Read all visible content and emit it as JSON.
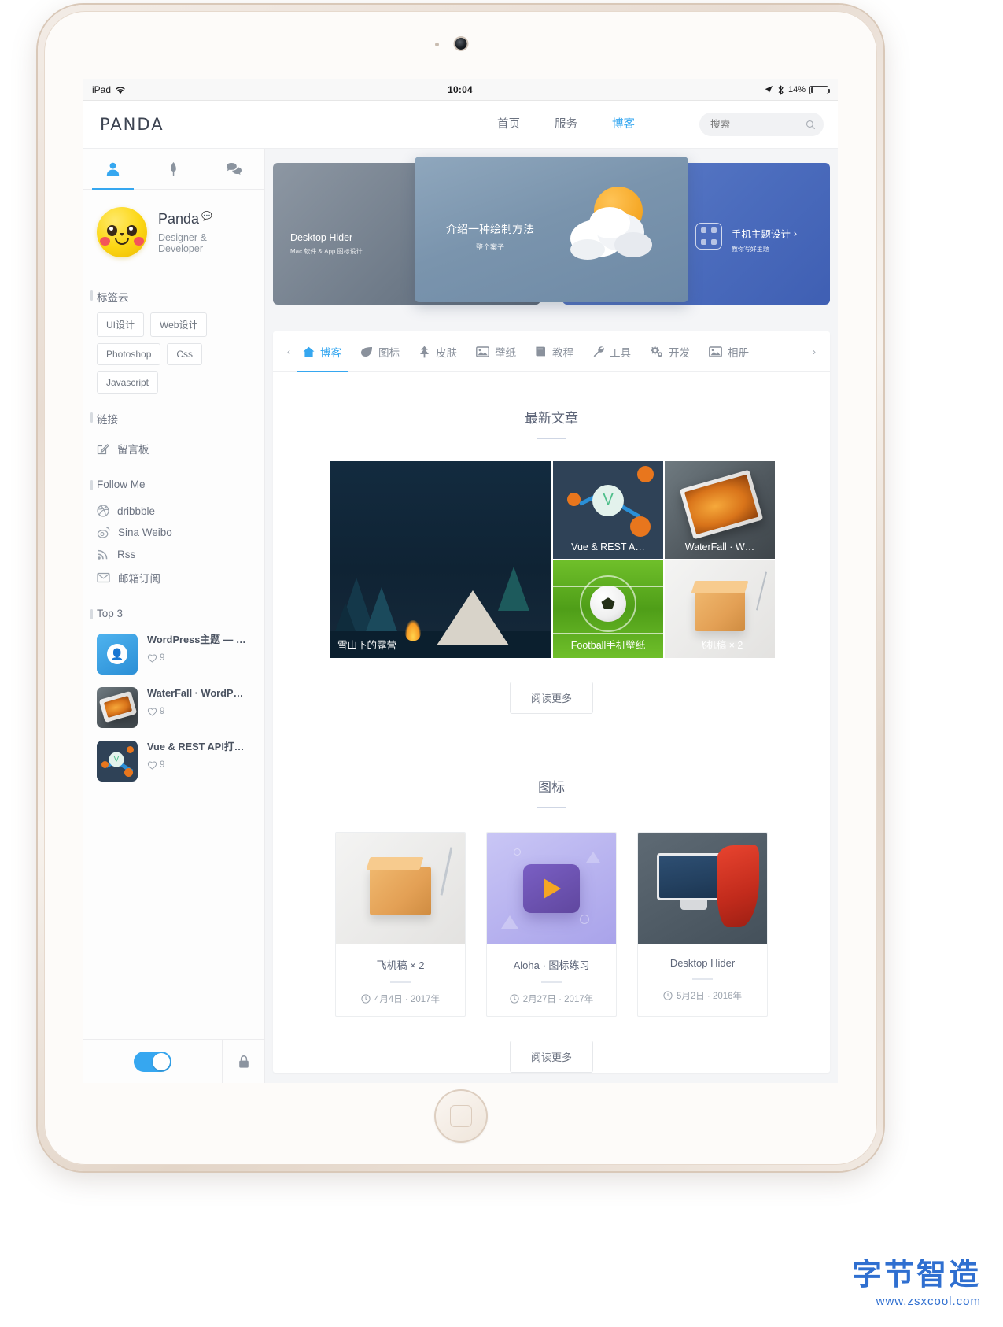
{
  "statusbar": {
    "carrier": "iPad",
    "wifi_icon": "wifi-icon",
    "time": "10:04",
    "location_icon": "location-arrow-icon",
    "bluetooth_icon": "bluetooth-icon",
    "battery_text": "14%"
  },
  "header": {
    "logo": "PANDA",
    "nav": [
      {
        "label": "首页",
        "active": false
      },
      {
        "label": "服务",
        "active": false
      },
      {
        "label": "博客",
        "active": true
      }
    ],
    "search": {
      "placeholder": "搜索",
      "value": "",
      "icon": "search-icon"
    }
  },
  "sidebar": {
    "tabs": [
      {
        "icon": "user-icon",
        "active": true
      },
      {
        "icon": "feather-icon",
        "active": false
      },
      {
        "icon": "comments-icon",
        "active": false
      }
    ],
    "profile": {
      "name": "Panda",
      "role": "Designer & Developer",
      "badge_icon": "speech-bubble-icon"
    },
    "tagcloud": {
      "title": "标签云",
      "tags": [
        "UI设计",
        "Web设计",
        "Photoshop",
        "Css",
        "Javascript"
      ]
    },
    "links": {
      "title": "链接",
      "items": [
        {
          "label": "留言板",
          "icon": "pencil-square-icon"
        }
      ]
    },
    "follow": {
      "title": "Follow Me",
      "items": [
        {
          "label": "dribbble",
          "icon": "dribbble-icon"
        },
        {
          "label": "Sina Weibo",
          "icon": "weibo-icon"
        },
        {
          "label": "Rss",
          "icon": "rss-icon"
        },
        {
          "label": "邮箱订阅",
          "icon": "envelope-icon"
        }
      ]
    },
    "top3": {
      "title": "Top 3",
      "items": [
        {
          "title": "WordPress主题 — …",
          "likes": "9",
          "thumb": "wordpress-avatar-thumb"
        },
        {
          "title": "WaterFall · WordP…",
          "likes": "9",
          "thumb": "waterfall-tablet-thumb"
        },
        {
          "title": "Vue & REST API打…",
          "likes": "9",
          "thumb": "vue-nodes-thumb"
        }
      ],
      "like_icon": "heart-icon"
    },
    "footer": {
      "toggle_on": true,
      "toggle_name": "night-mode-toggle",
      "lock_icon": "lock-icon"
    }
  },
  "carousel": {
    "slides": [
      {
        "title": "Desktop Hider",
        "subtitle": "Mac 软件 & App 图标设计",
        "position": "left"
      },
      {
        "title": "介绍一种绘制方法",
        "subtitle": "整个案子",
        "position": "center",
        "active": true
      },
      {
        "title": "手机主题设计",
        "subtitle": "教你写好主题",
        "position": "right"
      }
    ]
  },
  "category_tabs": {
    "prev_arrow": "chevron-left-icon",
    "next_arrow": "chevron-right-icon",
    "items": [
      {
        "label": "博客",
        "icon": "home-icon",
        "active": true
      },
      {
        "label": "图标",
        "icon": "leaf-icon",
        "active": false
      },
      {
        "label": "皮肤",
        "icon": "tree-icon",
        "active": false
      },
      {
        "label": "壁纸",
        "icon": "image-icon",
        "active": false
      },
      {
        "label": "教程",
        "icon": "book-icon",
        "active": false
      },
      {
        "label": "工具",
        "icon": "wrench-icon",
        "active": false
      },
      {
        "label": "开发",
        "icon": "gears-icon",
        "active": false
      },
      {
        "label": "相册",
        "icon": "photo-icon",
        "active": false
      }
    ]
  },
  "articles_section": {
    "title": "最新文章",
    "tiles": [
      {
        "caption": "雪山下的露营",
        "art": "camping"
      },
      {
        "caption": "Vue & REST A…",
        "art": "vue"
      },
      {
        "caption": "WaterFall · W…",
        "art": "waterfall"
      },
      {
        "caption": "Football手机壁纸",
        "art": "football"
      },
      {
        "caption": "飞机稿 × 2",
        "art": "box"
      }
    ],
    "more_label": "阅读更多"
  },
  "icons_section": {
    "title": "图标",
    "cards": [
      {
        "title": "飞机稿 × 2",
        "date": "4月4日 · 2017年",
        "art": "box",
        "clock_icon": "clock-icon"
      },
      {
        "title": "Aloha · 图标练习",
        "date": "2月27日 · 2017年",
        "art": "aloha",
        "clock_icon": "clock-icon"
      },
      {
        "title": "Desktop Hider",
        "date": "5月2日 · 2016年",
        "art": "desktophider",
        "clock_icon": "clock-icon"
      }
    ],
    "more_label": "阅读更多"
  },
  "watermark": {
    "title": "字节智造",
    "subtitle": "www.zsxcool.com"
  },
  "colors": {
    "accent": "#36a7f0",
    "text": "#5d6578",
    "muted": "#9aa2ac",
    "screen_bg": "#f4f5f7"
  }
}
